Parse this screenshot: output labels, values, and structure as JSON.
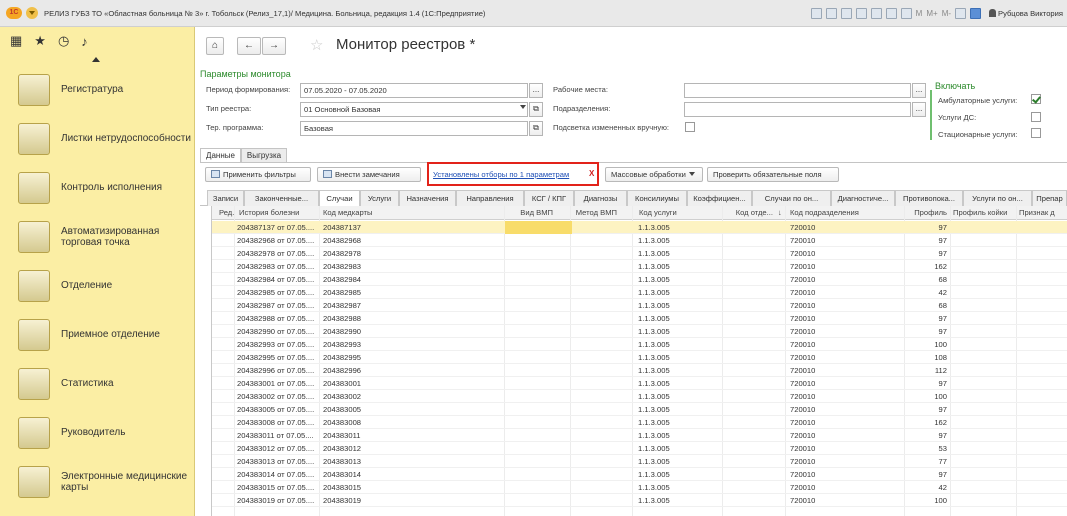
{
  "titlebar": {
    "logo": "1С",
    "title": "РЕЛИЗ ГУБЗ ТО «Областная больница № 3» г. Тобольск (Релиз_17,1)/ Медицина. Больница, редакция 1.4 (1С:Предприятие)",
    "tools": [
      "M",
      "M+",
      "M-"
    ],
    "user": "Рубцова Виктория"
  },
  "leftpanel": {
    "items": [
      {
        "label": "Регистратура",
        "icon": "registry-icon"
      },
      {
        "label": "Листки нетрудоспособности",
        "icon": "sick-leave-icon"
      },
      {
        "label": "Контроль исполнения",
        "icon": "first-aid-icon"
      },
      {
        "label": "Автоматизированная торговая точка",
        "icon": "cash-register-icon"
      },
      {
        "label": "Отделение",
        "icon": "hospital-bed-icon"
      },
      {
        "label": "Приемное отделение",
        "icon": "doctor-icon"
      },
      {
        "label": "Статистика",
        "icon": "clipboard-icon"
      },
      {
        "label": "Руководитель",
        "icon": "manager-icon"
      },
      {
        "label": "Электронные медицинские карты",
        "icon": "medical-records-icon"
      }
    ]
  },
  "header": {
    "title": "Монитор реестров *"
  },
  "params": {
    "title": "Параметры монитора",
    "period_label": "Период формирования:",
    "period_value": "07.05.2020 - 07.05.2020",
    "type_label": "Тип реестра:",
    "type_value": "01 Основной Базовая",
    "program_label": "Тер. программа:",
    "program_value": "Базовая",
    "workplaces_label": "Рабочие места:",
    "workplaces_value": "",
    "departments_label": "Подразделения:",
    "departments_value": "",
    "highlight_label": "Подсветка измененных вручную:",
    "highlight_checked": false
  },
  "include": {
    "title": "Включать",
    "items": [
      {
        "label": "Амбулаторные услуги:",
        "checked": true
      },
      {
        "label": "Услуги ДС:",
        "checked": false
      },
      {
        "label": "Стационарные услуги:",
        "checked": false
      }
    ]
  },
  "tabs": [
    "Данные",
    "Выгрузка"
  ],
  "toolbar": {
    "apply_filters": "Применить фильтры",
    "add_remarks": "Внести замечания",
    "filter_link": "Установлены отборы по 1 параметрам",
    "filter_clear": "X",
    "mass_processing": "Массовые обработки",
    "check_required": "Проверить обязательные поля"
  },
  "subtabs": [
    "Записи",
    "Законченные...",
    "Случаи",
    "Услуги",
    "Назначения",
    "Направления",
    "КСГ / КПГ",
    "Диагнозы",
    "Консилиумы",
    "Коэффициен...",
    "Случаи по он...",
    "Диагностиче...",
    "Противопока...",
    "Услуги по он...",
    "Препар"
  ],
  "active_subtab": "Случаи",
  "table": {
    "columns": [
      "Ред.",
      "История болезни",
      "Код медкарты",
      "Вид ВМП",
      "Метод ВМП",
      "Код услуги",
      "Код отде...",
      "Код подразделения",
      "Профиль",
      "Профиль койки",
      "Признак д"
    ],
    "sort_indicator": "↓",
    "rows": [
      {
        "history": "204387137 от 07.05....",
        "card": "204387137",
        "service": "1.1.3.005",
        "dept": "720010",
        "profile": "97"
      },
      {
        "history": "204382968 от 07.05....",
        "card": "204382968",
        "service": "1.1.3.005",
        "dept": "720010",
        "profile": "97"
      },
      {
        "history": "204382978 от 07.05....",
        "card": "204382978",
        "service": "1.1.3.005",
        "dept": "720010",
        "profile": "97"
      },
      {
        "history": "204382983 от 07.05....",
        "card": "204382983",
        "service": "1.1.3.005",
        "dept": "720010",
        "profile": "162"
      },
      {
        "history": "204382984 от 07.05....",
        "card": "204382984",
        "service": "1.1.3.005",
        "dept": "720010",
        "profile": "68"
      },
      {
        "history": "204382985 от 07.05....",
        "card": "204382985",
        "service": "1.1.3.005",
        "dept": "720010",
        "profile": "42"
      },
      {
        "history": "204382987 от 07.05....",
        "card": "204382987",
        "service": "1.1.3.005",
        "dept": "720010",
        "profile": "68"
      },
      {
        "history": "204382988 от 07.05....",
        "card": "204382988",
        "service": "1.1.3.005",
        "dept": "720010",
        "profile": "97"
      },
      {
        "history": "204382990 от 07.05....",
        "card": "204382990",
        "service": "1.1.3.005",
        "dept": "720010",
        "profile": "97"
      },
      {
        "history": "204382993 от 07.05....",
        "card": "204382993",
        "service": "1.1.3.005",
        "dept": "720010",
        "profile": "100"
      },
      {
        "history": "204382995 от 07.05....",
        "card": "204382995",
        "service": "1.1.3.005",
        "dept": "720010",
        "profile": "108"
      },
      {
        "history": "204382996 от 07.05....",
        "card": "204382996",
        "service": "1.1.3.005",
        "dept": "720010",
        "profile": "112"
      },
      {
        "history": "204383001 от 07.05....",
        "card": "204383001",
        "service": "1.1.3.005",
        "dept": "720010",
        "profile": "97"
      },
      {
        "history": "204383002 от 07.05....",
        "card": "204383002",
        "service": "1.1.3.005",
        "dept": "720010",
        "profile": "100"
      },
      {
        "history": "204383005 от 07.05....",
        "card": "204383005",
        "service": "1.1.3.005",
        "dept": "720010",
        "profile": "97"
      },
      {
        "history": "204383008 от 07.05....",
        "card": "204383008",
        "service": "1.1.3.005",
        "dept": "720010",
        "profile": "162"
      },
      {
        "history": "204383011 от 07.05....",
        "card": "204383011",
        "service": "1.1.3.005",
        "dept": "720010",
        "profile": "97"
      },
      {
        "history": "204383012 от 07.05....",
        "card": "204383012",
        "service": "1.1.3.005",
        "dept": "720010",
        "profile": "53"
      },
      {
        "history": "204383013 от 07.05....",
        "card": "204383013",
        "service": "1.1.3.005",
        "dept": "720010",
        "profile": "77"
      },
      {
        "history": "204383014 от 07.05....",
        "card": "204383014",
        "service": "1.1.3.005",
        "dept": "720010",
        "profile": "97"
      },
      {
        "history": "204383015 от 07.05....",
        "card": "204383015",
        "service": "1.1.3.005",
        "dept": "720010",
        "profile": "42"
      },
      {
        "history": "204383019 от 07.05....",
        "card": "204383019",
        "service": "1.1.3.005",
        "dept": "720010",
        "profile": "100"
      }
    ]
  },
  "colors": {
    "left_panel_bg": "#fbeea4",
    "selected_row": "#fdf3c2",
    "accent_green": "#2c8a2c",
    "filter_highlight": "#e2231a",
    "link": "#1f4fb5"
  }
}
